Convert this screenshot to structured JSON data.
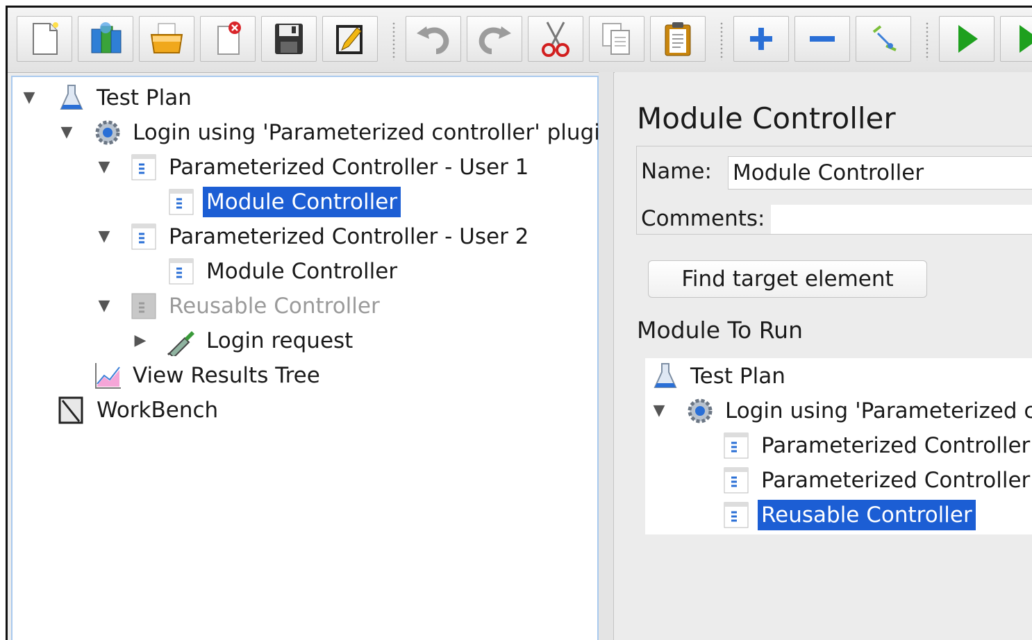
{
  "toolbar": {
    "buttons": [
      {
        "name": "new-icon"
      },
      {
        "name": "templates-icon"
      },
      {
        "name": "open-icon"
      },
      {
        "name": "close-icon"
      },
      {
        "name": "save-icon"
      },
      {
        "name": "edit-icon"
      },
      {
        "name": "undo-icon"
      },
      {
        "name": "redo-icon"
      },
      {
        "name": "cut-icon"
      },
      {
        "name": "copy-icon"
      },
      {
        "name": "paste-icon"
      },
      {
        "name": "expand-icon"
      },
      {
        "name": "collapse-icon"
      },
      {
        "name": "toggle-icon"
      },
      {
        "name": "start-icon"
      },
      {
        "name": "start-no-pause-icon"
      }
    ]
  },
  "tree": {
    "test_plan": "Test Plan",
    "login_group": "Login using 'Parameterized controller' plugin",
    "param_user1": "Parameterized Controller - User 1",
    "module_ctrl_1": "Module Controller",
    "param_user2": "Parameterized Controller - User 2",
    "module_ctrl_2": "Module Controller",
    "reusable": "Reusable Controller",
    "login_request": "Login request",
    "view_results": "View Results Tree",
    "workbench": "WorkBench"
  },
  "panel": {
    "title": "Module Controller",
    "name_label": "Name:",
    "name_value": "Module Controller",
    "comments_label": "Comments:",
    "find_button": "Find target element",
    "module_to_run": "Module To Run"
  },
  "module_tree": {
    "test_plan": "Test Plan",
    "login_group": "Login using 'Parameterized co",
    "param1": "Parameterized Controller",
    "param2": "Parameterized Controller",
    "reusable": "Reusable Controller"
  },
  "colors": {
    "selection": "#1c5ed4",
    "run_green": "#1ea01e",
    "tree_border": "#a9c9ee"
  }
}
